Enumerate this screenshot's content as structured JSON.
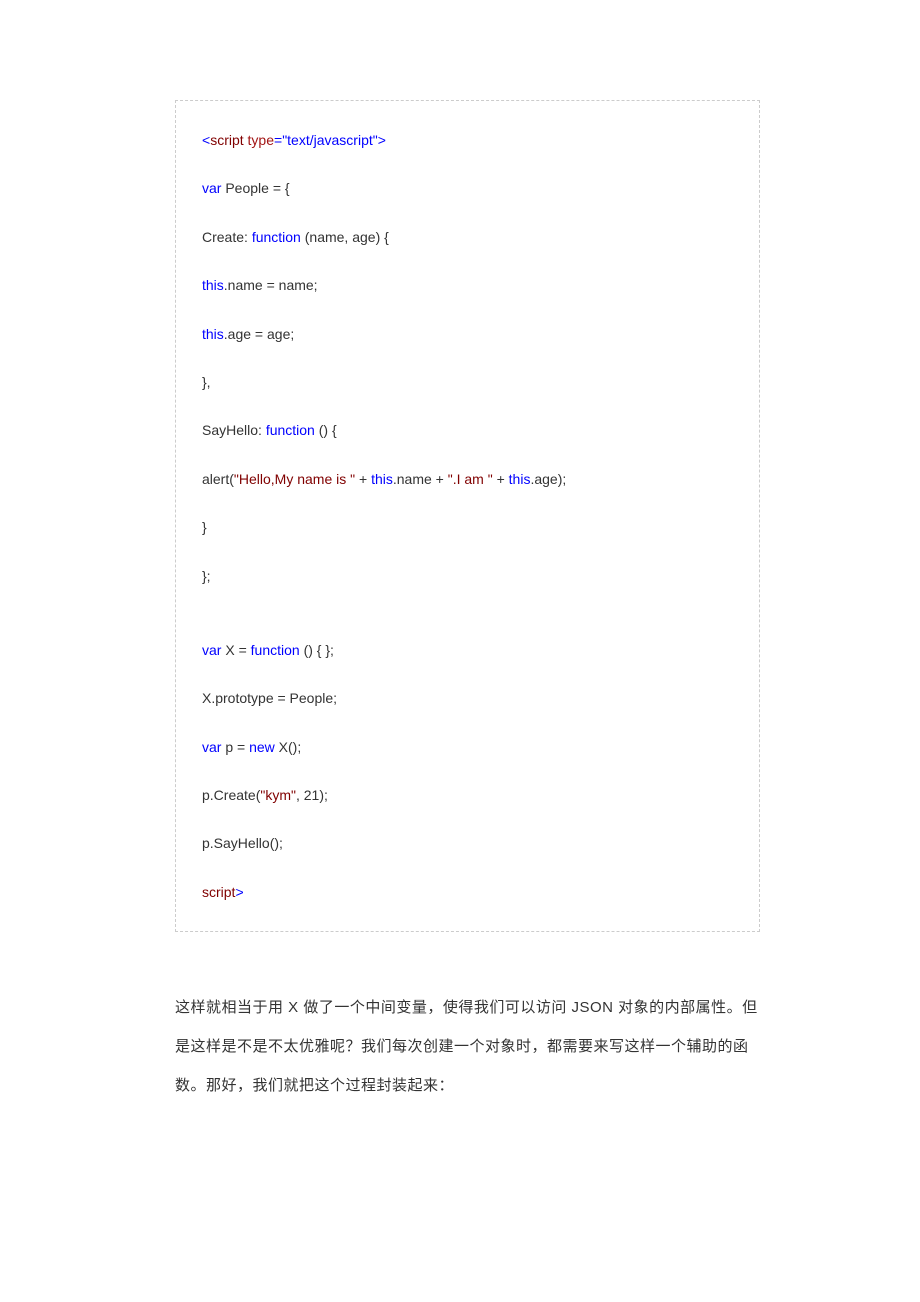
{
  "code": {
    "l1_open": "<",
    "l1_tag": "script ",
    "l1_attr_name": "type",
    "l1_eq": "=",
    "l1_attr_val": "\"text/javascript\"",
    "l1_close": ">",
    "l2_var": "var",
    "l2_rest": " People = {",
    "l3_a": "Create: ",
    "l3_b": "function",
    "l3_c": " (name, age) {",
    "l4_a": "this",
    "l4_b": ".name = name;",
    "l5_a": "this",
    "l5_b": ".age = age;",
    "l6": "},",
    "l7_a": "SayHello: ",
    "l7_b": "function",
    "l7_c": " () {",
    "l8_a": "alert(",
    "l8_b": "\"Hello,My name is \"",
    "l8_c": " + ",
    "l8_d": "this",
    "l8_e": ".name + ",
    "l8_f": "\".I am \"",
    "l8_g": " + ",
    "l8_h": "this",
    "l8_i": ".age);",
    "l9": "}",
    "l10": "};",
    "l11_a": "var",
    "l11_b": " X = ",
    "l11_c": "function",
    "l11_d": " () { };",
    "l12": "X.prototype = People;",
    "l13_a": "var",
    "l13_b": " p = ",
    "l13_c": "new",
    "l13_d": " X();",
    "l14_a": "p.Create(",
    "l14_b": "\"kym\"",
    "l14_c": ", 21);",
    "l15": "p.SayHello();",
    "l16_tag": "script",
    "l16_close": ">"
  },
  "prose": {
    "text": "这样就相当于用 X 做了一个中间变量，使得我们可以访问 JSON 对象的内部属性。但是这样是不是不太优雅呢？我们每次创建一个对象时，都需要来写这样一个辅助的函数。那好，我们就把这个过程封装起来："
  }
}
